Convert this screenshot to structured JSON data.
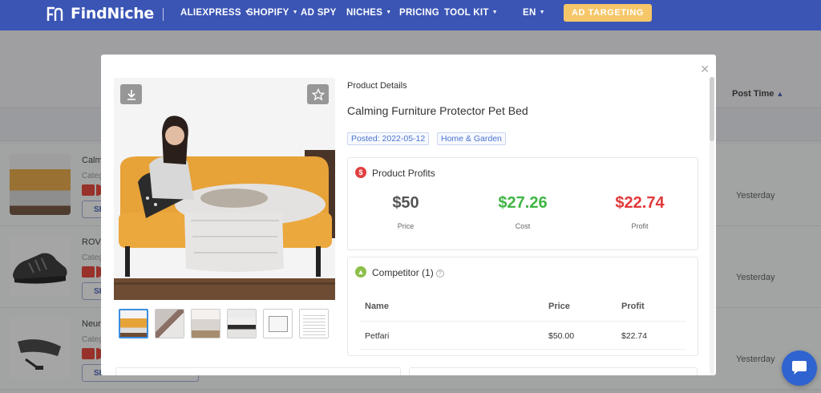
{
  "nav": {
    "brand": "FindNiche",
    "items": [
      {
        "label": "ALIEXPRESS",
        "dropdown": true
      },
      {
        "label": "SHOPIFY",
        "dropdown": true
      },
      {
        "label": "AD SPY",
        "dropdown": false
      },
      {
        "label": "NICHES",
        "dropdown": true
      },
      {
        "label": "PRICING",
        "dropdown": false
      },
      {
        "label": "TOOL KIT",
        "dropdown": true
      }
    ],
    "language": "EN",
    "cta": "AD TARGETING"
  },
  "background": {
    "sort_column": "Post Time",
    "rows": [
      {
        "title": "Calm",
        "category": "Categ",
        "action": "SH",
        "post_time": "Yesterday"
      },
      {
        "title": "ROVU",
        "category": "Categ",
        "action": "SH",
        "post_time": "Yesterday"
      },
      {
        "title": "Neur",
        "category": "Categ",
        "action": "SHOW ME THE MONEY",
        "post_time": "Yesterday"
      }
    ]
  },
  "modal": {
    "section_label": "Product Details",
    "product_title": "Calming Furniture Protector Pet Bed",
    "posted": "Posted: 2022-05-12",
    "category": "Home & Garden",
    "profits": {
      "title": "Product Profits",
      "price": {
        "value": "$50",
        "label": "Price"
      },
      "cost": {
        "value": "$27.26",
        "label": "Cost"
      },
      "profit": {
        "value": "$22.74",
        "label": "Profit"
      }
    },
    "competitor": {
      "title": "Competitor (1)",
      "columns": [
        "Name",
        "Price",
        "Profit"
      ],
      "rows": [
        {
          "name": "Petfari",
          "price": "$50.00",
          "profit": "$22.74"
        }
      ]
    },
    "thumbnail_count": 6,
    "close_icon": "close-icon"
  },
  "colors": {
    "nav_bg": "#3b55b5",
    "cta_bg": "#f6c768",
    "price": "#555555",
    "cost": "#3fb544",
    "profit": "#e2383a",
    "tag": "#4a74d0"
  }
}
